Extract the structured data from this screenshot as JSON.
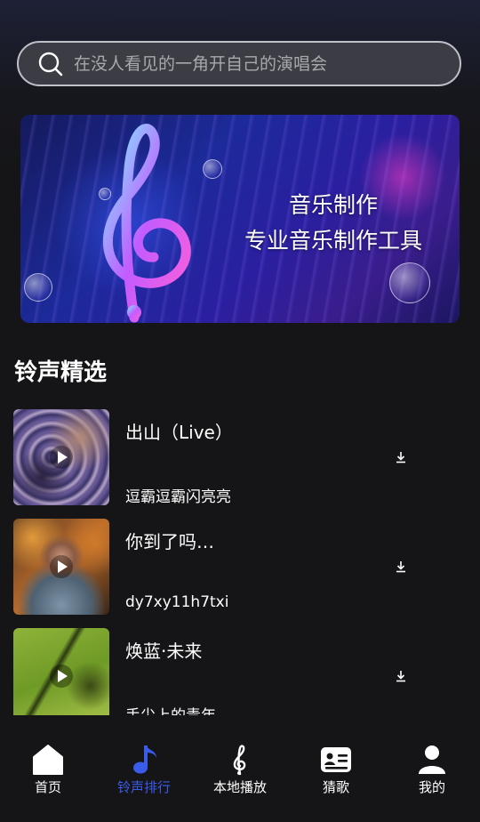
{
  "search": {
    "placeholder": "在没人看见的一角开自己的演唱会"
  },
  "banner": {
    "line1": "音乐制作",
    "line2": "专业音乐制作工具"
  },
  "section": {
    "title": "铃声精选"
  },
  "songs": [
    {
      "title": "出山（Live）",
      "artist": "逗霸逗霸闪亮亮"
    },
    {
      "title": "你到了吗…",
      "artist": "dy7xy11h7txi"
    },
    {
      "title": "焕蓝·未来",
      "artist": "手尖上的青年"
    }
  ],
  "nav": {
    "items": [
      {
        "label": "首页",
        "icon": "home-icon"
      },
      {
        "label": "铃声排行",
        "icon": "music-note-icon",
        "active": true
      },
      {
        "label": "本地播放",
        "icon": "treble-clef-icon"
      },
      {
        "label": "猜歌",
        "icon": "id-card-icon"
      },
      {
        "label": "我的",
        "icon": "user-icon"
      }
    ]
  },
  "colors": {
    "accent": "#3b5bea",
    "background": "#151517"
  }
}
